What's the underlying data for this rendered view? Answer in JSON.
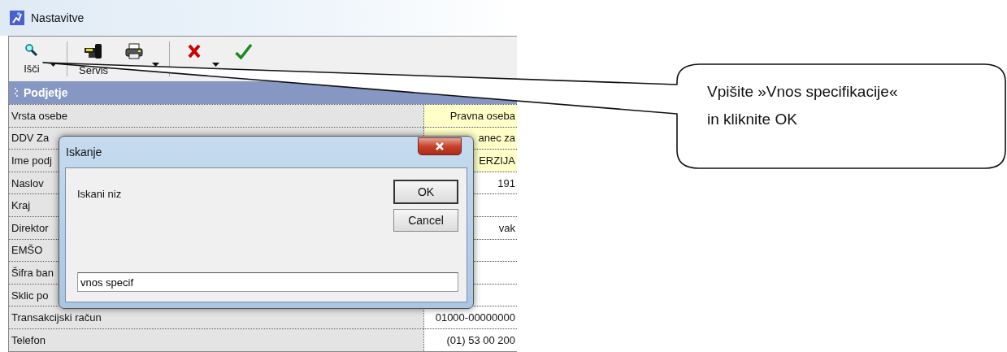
{
  "window": {
    "title": "Nastavitve"
  },
  "toolbar": [
    {
      "label": "Išči",
      "kind": "search",
      "dropdown": true
    },
    {
      "label": "Servis",
      "kind": "service",
      "dropdown": false
    },
    {
      "kind": "print",
      "dropdown": true
    },
    {
      "kind": "cancel",
      "dropdown": true
    },
    {
      "kind": "close",
      "dropdown": false
    }
  ],
  "section": {
    "title": "Podjetje"
  },
  "rows": [
    {
      "label": "Vrsta osebe",
      "value": "Pravna oseba",
      "highlighted": true
    },
    {
      "label": "DDV Za",
      "value": "anec za",
      "highlighted": true
    },
    {
      "label": "Ime podj",
      "value": "ERZIJA",
      "highlighted": true
    },
    {
      "label": "Naslov",
      "value": "191",
      "highlighted": false
    },
    {
      "label": "Kraj",
      "highlighted": false
    },
    {
      "label": "Direktor",
      "value": "vak",
      "highlighted": false
    },
    {
      "label": "EMŠO",
      "highlighted": false
    },
    {
      "label": "Šifra ban",
      "highlighted": false
    },
    {
      "label": "Sklic po",
      "highlighted": false
    },
    {
      "label": "Transakcijski račun",
      "value": "01000-00000000",
      "highlighted": false
    },
    {
      "label": "Telefon",
      "value": "(01) 53 00 200",
      "highlighted": false
    }
  ],
  "dialog": {
    "title": "Iskanje",
    "label": "Iskani niz",
    "value": "vnos specif",
    "buttons": [
      "OK",
      "Cancel"
    ]
  },
  "callout": {
    "text": "Vpišite »Vnos specifikacije« in kliknite OK"
  }
}
